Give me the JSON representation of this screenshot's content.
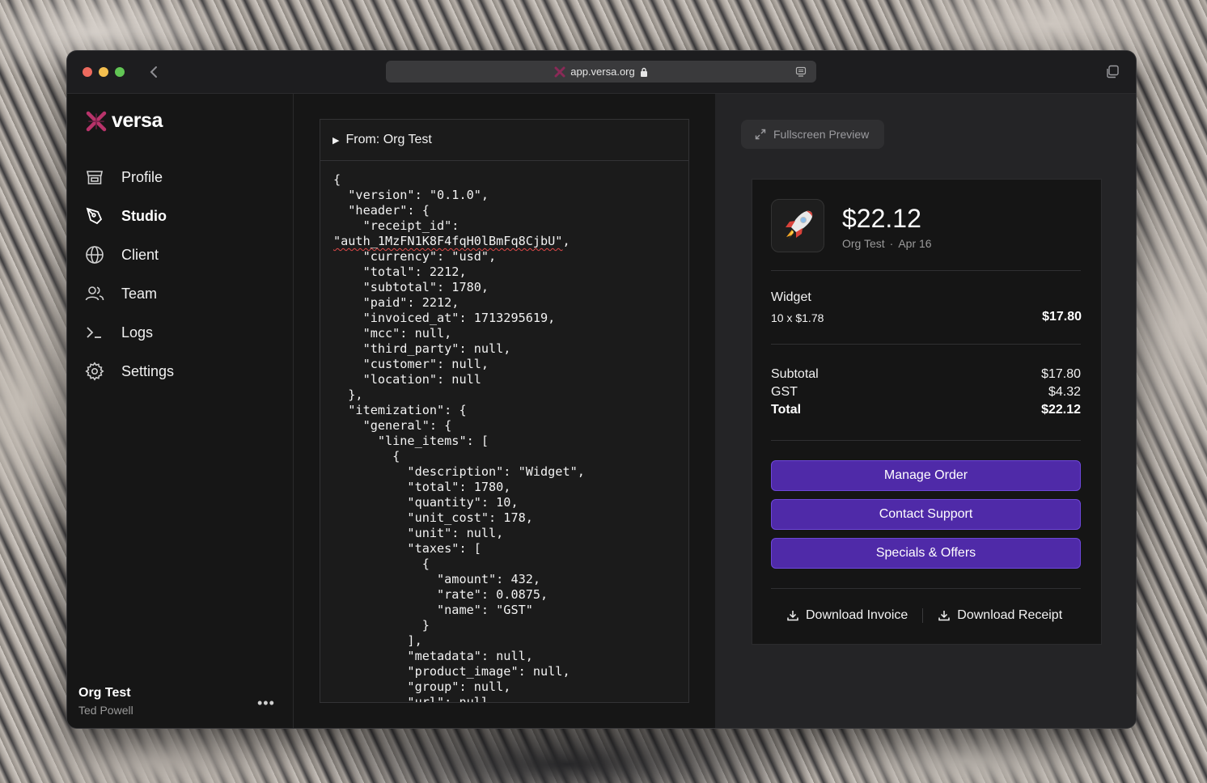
{
  "browser": {
    "url": "app.versa.org"
  },
  "brand": {
    "name": "versa",
    "accent": "#b8336a"
  },
  "sidebar": {
    "items": [
      {
        "label": "Profile",
        "icon": "storefront-icon",
        "active": false
      },
      {
        "label": "Studio",
        "icon": "pen-tool-icon",
        "active": true
      },
      {
        "label": "Client",
        "icon": "globe-icon",
        "active": false
      },
      {
        "label": "Team",
        "icon": "users-icon",
        "active": false
      },
      {
        "label": "Logs",
        "icon": "terminal-icon",
        "active": false
      },
      {
        "label": "Settings",
        "icon": "gear-icon",
        "active": false
      }
    ],
    "org_name": "Org Test",
    "user_name": "Ted Powell",
    "more_label": "•••"
  },
  "json_panel": {
    "summary": "From: Org Test",
    "code_before": "{\n  \"version\": \"0.1.0\",\n  \"header\": {\n    \"receipt_id\":\n",
    "receipt_id_value": "\"auth_1MzFN1K8F4fqH0lBmFq8CjbU\"",
    "code_after": ",\n    \"currency\": \"usd\",\n    \"total\": 2212,\n    \"subtotal\": 1780,\n    \"paid\": 2212,\n    \"invoiced_at\": 1713295619,\n    \"mcc\": null,\n    \"third_party\": null,\n    \"customer\": null,\n    \"location\": null\n  },\n  \"itemization\": {\n    \"general\": {\n      \"line_items\": [\n        {\n          \"description\": \"Widget\",\n          \"total\": 1780,\n          \"quantity\": 10,\n          \"unit_cost\": 178,\n          \"unit\": null,\n          \"taxes\": [\n            {\n              \"amount\": 432,\n              \"rate\": 0.0875,\n              \"name\": \"GST\"\n            }\n          ],\n          \"metadata\": null,\n          \"product_image\": null,\n          \"group\": null,\n          \"url\": null"
  },
  "preview": {
    "fullscreen_label": "Fullscreen Preview",
    "receipt": {
      "logo_icon": "rocket-icon",
      "total": "$22.12",
      "merchant": "Org Test",
      "separator": "·",
      "date": "Apr 16",
      "item": {
        "name": "Widget",
        "qty_line": "10 x $1.78",
        "total": "$17.80"
      },
      "summary": [
        {
          "label": "Subtotal",
          "value": "$17.80"
        },
        {
          "label": "GST",
          "value": "$4.32"
        },
        {
          "label": "Total",
          "value": "$22.12"
        }
      ],
      "actions": [
        "Manage Order",
        "Contact Support",
        "Specials & Offers"
      ],
      "download_invoice": "Download Invoice",
      "download_receipt": "Download Receipt",
      "button_color": "#4f2aa8"
    }
  }
}
